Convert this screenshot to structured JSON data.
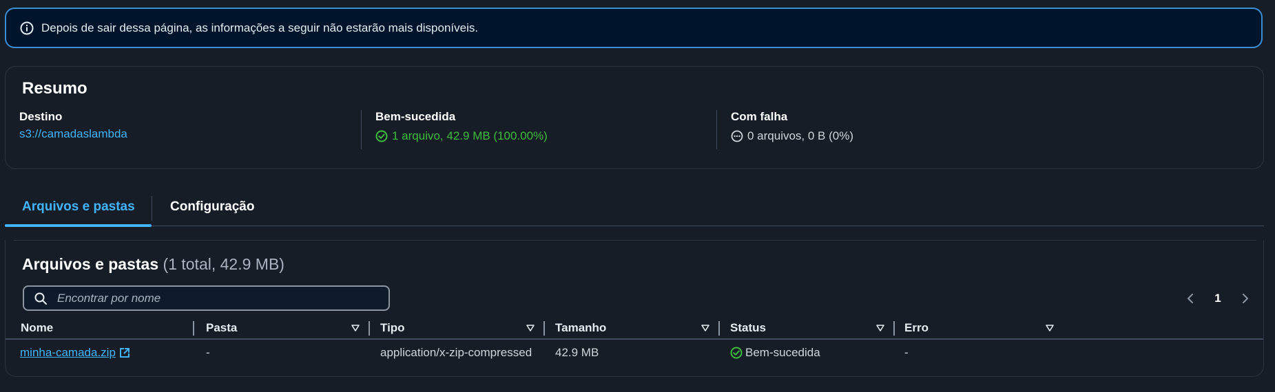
{
  "banner": {
    "icon": "info-icon",
    "text": "Depois de sair dessa página, as informações a seguir não estarão mais disponíveis."
  },
  "summary": {
    "title": "Resumo",
    "destination": {
      "label": "Destino",
      "value": "s3://camadaslambda"
    },
    "succeeded": {
      "label": "Bem-sucedida",
      "icon": "success-check-icon",
      "value": "1 arquivo, 42.9 MB (100.00%)"
    },
    "failed": {
      "label": "Com falha",
      "icon": "pending-dots-icon",
      "value": "0 arquivos, 0 B (0%)"
    }
  },
  "tabs": [
    {
      "label": "Arquivos e pastas",
      "active": true
    },
    {
      "label": "Configuração",
      "active": false
    }
  ],
  "files": {
    "heading": "Arquivos e pastas",
    "count": "(1 total, 42.9 MB)",
    "search_placeholder": "Encontrar por nome",
    "pagination": {
      "current_page": "1"
    },
    "columns": [
      "Nome",
      "Pasta",
      "Tipo",
      "Tamanho",
      "Status",
      "Erro"
    ],
    "rows": [
      {
        "name": "minha-camada.zip",
        "folder": "-",
        "type": "application/x-zip-compressed",
        "size": "42.9 MB",
        "status": "Bem-sucedida",
        "error": "-"
      }
    ]
  },
  "colors": {
    "accent": "#42b4ff",
    "success": "#3dbd3d",
    "background": "#161d26",
    "banner_border": "#3b8fd6"
  }
}
